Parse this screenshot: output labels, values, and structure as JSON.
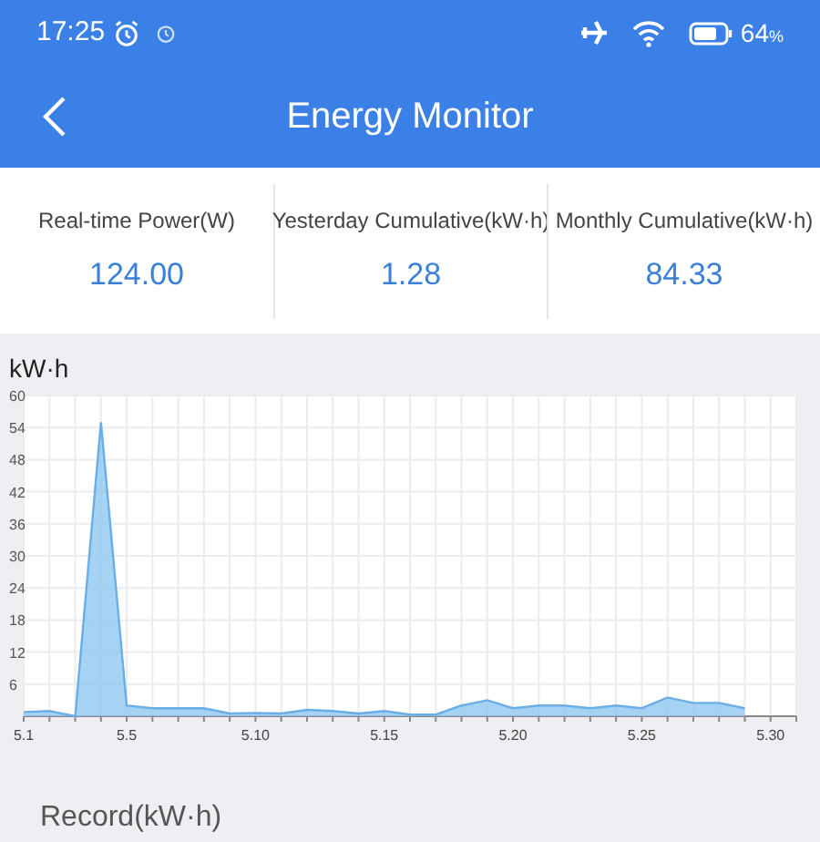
{
  "status_bar": {
    "time": "17:25",
    "battery": "64",
    "battery_unit": "%"
  },
  "header": {
    "title": "Energy Monitor"
  },
  "stats": [
    {
      "label": "Real-time Power(W)",
      "value": "124.00"
    },
    {
      "label": "Yesterday Cumulative(kW·h)",
      "value": "1.28"
    },
    {
      "label": "Monthly Cumulative(kW·h)",
      "value": "84.33"
    }
  ],
  "chart": {
    "chart_data": {
      "type": "area",
      "ylabel": "kW·h",
      "grid": true,
      "categories": [
        "5.1",
        null,
        null,
        null,
        "5.5",
        null,
        null,
        null,
        null,
        "5.10",
        null,
        null,
        null,
        null,
        "5.15",
        null,
        null,
        null,
        null,
        "5.20",
        null,
        null,
        null,
        null,
        "5.25",
        null,
        null,
        null,
        null,
        "5.30",
        null
      ],
      "series": [
        {
          "color": "#90c8f0",
          "values": [
            0.8,
            1,
            0,
            55,
            2,
            1.5,
            1.5,
            1.5,
            0.5,
            0.6,
            0.5,
            1.2,
            1,
            0.5,
            1,
            0.3,
            0.3,
            2,
            3,
            1.5,
            2,
            2,
            1.5,
            2,
            1.5,
            3.5,
            2.5,
            2.5,
            1.5,
            null,
            null
          ]
        }
      ],
      "ylim": [
        0,
        60
      ],
      "yticks": [
        6,
        12,
        18,
        24,
        30,
        36,
        42,
        48,
        54,
        60
      ]
    }
  },
  "record": {
    "title": "Record(kW·h)"
  }
}
